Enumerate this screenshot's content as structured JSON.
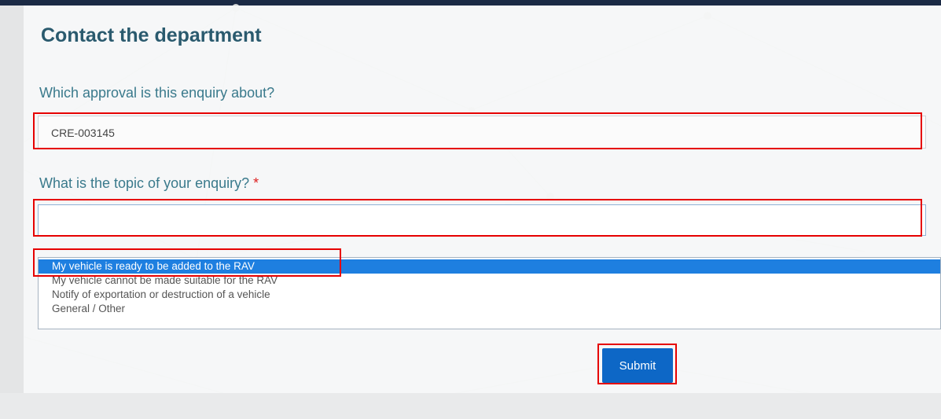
{
  "form": {
    "title": "Contact the department",
    "approval": {
      "label": "Which approval is this enquiry about?",
      "value": "CRE-003145"
    },
    "topic": {
      "label": "What is the topic of your enquiry?",
      "required_marker": "*",
      "value": "",
      "options": [
        "My vehicle is ready to be added to the RAV",
        "My vehicle cannot be made suitable for the RAV",
        "Notify of exportation or destruction of a vehicle",
        "General / Other"
      ],
      "highlighted_option_index": 0
    },
    "submit_label": "Submit"
  },
  "colors": {
    "title": "#2a5a6e",
    "label": "#3a7a8c",
    "highlight_box": "#e60000",
    "selected_option": "#1e7fe0",
    "submit_button": "#0d67c6"
  }
}
